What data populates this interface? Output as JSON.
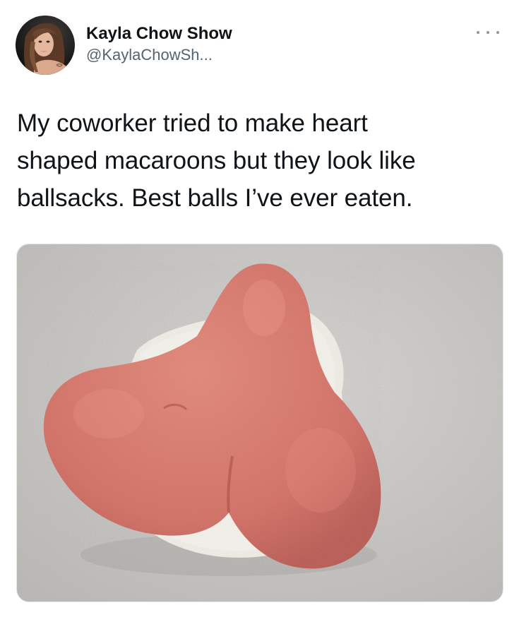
{
  "tweet": {
    "author": {
      "display_name": "Kayla Chow Show",
      "handle": "@KaylaChowSh..."
    },
    "text": "My coworker tried to make heart\nshaped macaroons but they look like\nballsacks. Best balls I’ve ever eaten.",
    "media": {
      "subject": "pink heart-shaped macaroon on gray countertop",
      "colors": {
        "countertop": "#c9c7c4",
        "cookie": "#d9766b",
        "filling": "#efeee6"
      }
    }
  },
  "icons": {
    "more": "more-horizontal-icon"
  },
  "colors": {
    "text": "#0f1419",
    "secondary": "#536471",
    "dots": "#8b98a5"
  }
}
